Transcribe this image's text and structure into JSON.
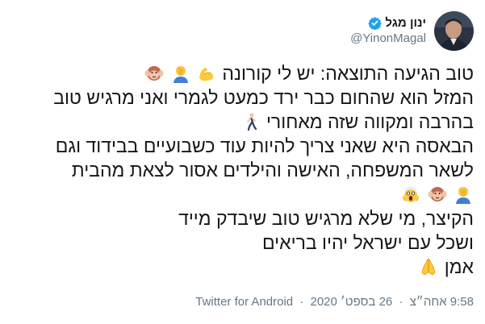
{
  "author": {
    "display_name": "ינון מגל",
    "handle": "@YinonMagal",
    "verified_icon": "verified-badge-icon"
  },
  "body": {
    "line1": "טוב הגיעה התוצאה: יש לי קורונה",
    "line2": "המזל הוא שהחום כבר ירד כמעט לגמרי ואני מרגיש טוב",
    "line3": "בהרבה ומקווה שזה מאחורי",
    "line4": "הבאסה היא שאני צריך להיות עוד כשבועיים בבידוד וגם",
    "line5": "לשאר המשפחה, האישה והילדים אסור לצאת מהבית",
    "line7": "הקיצר, מי שלא מרגיש טוב שיבדק מייד",
    "line8": "ושכל עם ישראל יהיו בריאים",
    "line9": "אמן"
  },
  "emojis": {
    "line1": [
      "flexed-biceps-icon",
      "person-facepalming-icon",
      "hear-no-evil-monkey-icon"
    ],
    "line3": [
      "person-walking-icon"
    ],
    "line6": [
      "person-facepalming-icon",
      "hear-no-evil-monkey-icon",
      "face-screaming-icon"
    ],
    "line9": [
      "folded-hands-icon"
    ]
  },
  "footer": {
    "time": "9:58 אחה״צ",
    "separator1": "·",
    "date": "26 בספט׳ 2020",
    "separator2": "·",
    "source": "Twitter for Android"
  },
  "colors": {
    "text": "#14171a",
    "secondary": "#657786",
    "verified": "#1da1f2",
    "emoji_yellow": "#ffc83d",
    "monkey_brown": "#bf6952"
  }
}
